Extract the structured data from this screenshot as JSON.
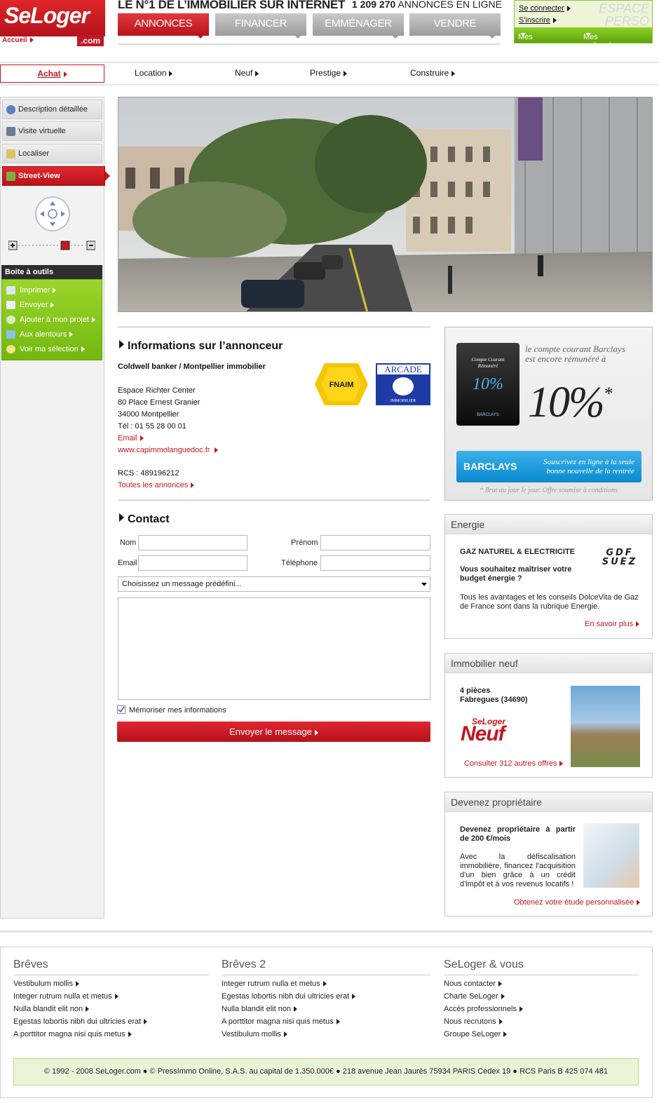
{
  "logo": {
    "brand": "SeLoger",
    "suffix": ".com",
    "home_link": "Accueil"
  },
  "header": {
    "tagline": "LE N°1 DE L’IMMOBILIER SUR INTERNET",
    "count_number": "1 209 270",
    "count_label": "ANNONCES EN LIGNE",
    "tabs": [
      "ANNONCES",
      "FINANCER",
      "EMMÉNAGER",
      "VENDRE"
    ]
  },
  "espace": {
    "watermark": "ESPACE PERSO",
    "login": "Se connecter",
    "register": "S'inscrire",
    "my_ads": "Mes annonces",
    "my_searches": "Mes recherches"
  },
  "subnav": [
    "Achat",
    "Location",
    "Neuf",
    "Prestige",
    "Construire"
  ],
  "sidebar": {
    "items": [
      "Description détaillée",
      "Visite virtuelle",
      "Localiser",
      "Street-View"
    ],
    "toolbox_title": "Boite à outils",
    "tools": [
      "Imprimer",
      "Envoyer",
      "Ajouter à mon projet",
      "Aux alentours",
      "Voir ma sélection"
    ]
  },
  "info": {
    "title": "Informations sur l’annonceur",
    "agency": "Coldwell banker / Montpellier immobilier",
    "address1": "Espace Richter Center",
    "address2": "80 Place Ernest Granier",
    "address3": "34000 Montpellier",
    "phone": "Tél : 01 55 28 00 01",
    "email": "Email",
    "website": "www.capimmolanguedoc.fr",
    "rcs": "RCS : 489196212",
    "all_ads": "Toutes les annonces",
    "logo1": "FNAIM",
    "logo2_title": "ARCADE",
    "logo2_sub": "IMMOBILIER"
  },
  "contact": {
    "title": "Contact",
    "nom": "Nom",
    "prenom": "Prénom",
    "email": "Email",
    "telephone": "Téléphone",
    "select": "Choisissez un message prédéfini...",
    "remember": "Mémoriser mes informations",
    "send": "Envoyer le message"
  },
  "barclays": {
    "card_line1": "Compte Courant",
    "card_line2": "Rémunéré",
    "card_rate": "10%",
    "card_bank": "BARCLAYS",
    "headline1": "le compte courant Barclays",
    "headline2": "est encore rémunéré à",
    "rate": "10%",
    "brand": "BARCLAYS",
    "cta1": "Souscrivez en ligne à la seule",
    "cta2": "bonne nouvelle de la rentrée",
    "note": "* Brut au jour le jour. Offre soumise à conditions"
  },
  "energie": {
    "title": "Energie",
    "heading": "GAZ NATUREL & ELECTRICITE",
    "question": "Vous souhaitez maîtriser votre budget énergie ?",
    "text": "Tous les avantages et les conseils DolceVita de Gaz de France sont dans la rubrique Energie.",
    "link": "En savoir plus",
    "logo1": "GDF",
    "logo2": "SUEZ"
  },
  "neuf": {
    "title": "Immobilier neuf",
    "rooms": "4 pièces",
    "city": "Fabregues (34690)",
    "logo_top": "SeLoger",
    "logo_bottom": "Neuf",
    "link": "Consulter 312 autres offres"
  },
  "proprio": {
    "title": "Devenez propriétaire",
    "heading": "Devenez propriétaire à partir de 200 €/mois",
    "text": "Avec la défiscalisation immobilière, financez l'acquisition d'un bien grâce à un crédit d'impôt et à vos revenus locatifs !",
    "link": "Obtenez votre étude personnalisée"
  },
  "footer": {
    "columns": [
      {
        "title": "Brêves",
        "links": [
          "Vestibulum mollis",
          "Integer rutrum nulla et metus",
          "Nulla blandit elit non",
          "Egestas lobortis nibh dui ultricies erat",
          "A porttitor magna nisi quis metus"
        ]
      },
      {
        "title": "Brêves 2",
        "links": [
          "Integer rutrum nulla et metus",
          "Egestas lobortis nibh dui ultricies erat",
          "Nulla blandit elit non",
          "A porttitor magna nisi quis metus",
          "Vestibulum mollis"
        ]
      },
      {
        "title": "SeLoger & vous",
        "links": [
          "Nous contacter",
          "Charte SeLoger",
          "Accès professionnels",
          "Nous recrutons",
          "Groupe SeLoger"
        ]
      }
    ],
    "copyright": "© 1992 - 2008 SeLoger.com ● © PressImmo Online, S.A.S. au capital de 1.350.000€ ● 218 avenue Jean Jaurès 75934 PARIS Cedex 19 ● RCS Paris B 425 074 481"
  },
  "colors": {
    "brand_red": "#c41622",
    "green": "#7dbf1a",
    "tab_grey": "#a9a9a9"
  }
}
